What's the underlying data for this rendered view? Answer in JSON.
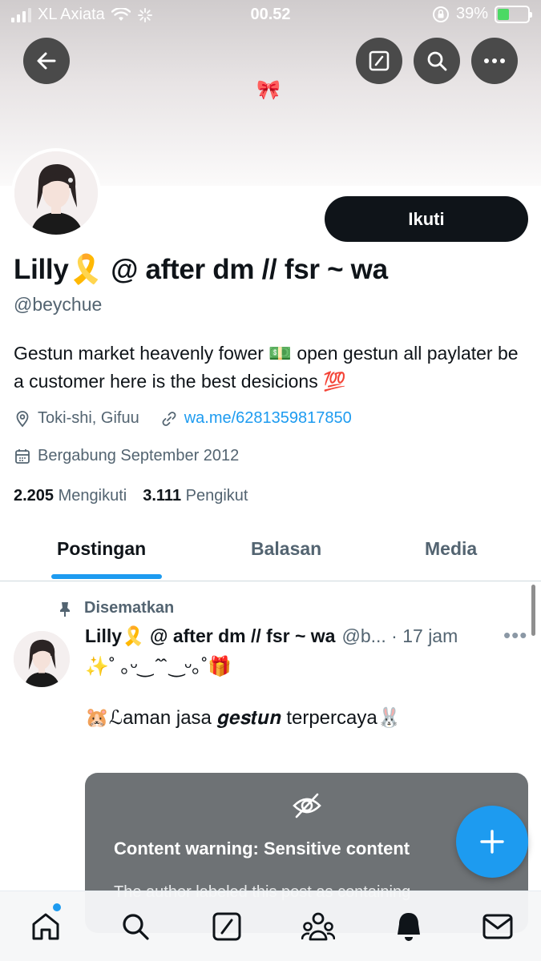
{
  "status_bar": {
    "carrier": "XL Axiata",
    "time": "00.52",
    "battery": "39%",
    "battery_level": 0.39
  },
  "header": {
    "icons": [
      "back-arrow-icon",
      "compose-icon",
      "search-icon",
      "more-icon",
      "bow-icon"
    ],
    "bow": "🎀"
  },
  "profile": {
    "display_name": "Lilly🎗️  @ after dm // fsr ~ wa",
    "handle": "@beychue",
    "bio": "Gestun market heavenly fower 💵 open gestun all paylater be a customer here is the best desicions 💯",
    "location": "Toki-shi, Gifuu",
    "website": "wa.me/6281359817850",
    "joined": "Bergabung September 2012",
    "following_count": "2.205",
    "following_label": "Mengikuti",
    "followers_count": "3.111",
    "followers_label": "Pengikut",
    "follow_button": "Ikuti"
  },
  "tabs": [
    {
      "label": "Postingan",
      "active": true
    },
    {
      "label": "Balasan",
      "active": false
    },
    {
      "label": "Media",
      "active": false
    }
  ],
  "post": {
    "pinned_label": "Disematkan",
    "author_name": "Lilly🎗️  @ after dm // fsr ~ wa",
    "author_meta": "@b... · 17 jam",
    "line1": "✨˚ ｡ᵕ‿ ̂ ̂ ‿ᵕ｡˚🎁",
    "line2": "🐹ℒaman jasa 𝒈𝒆𝒔𝒕𝒖𝒏 terpercaya🐰",
    "warning_title": "Content warning: Sensitive content",
    "warning_body": "The author labeled this post as containing"
  },
  "colors": {
    "accent": "#1d9bf0",
    "text": "#0f1419",
    "secondary": "#536471",
    "warning_bg": "#6e7275"
  },
  "bottom_nav": [
    "home-icon",
    "search-icon",
    "grok-icon",
    "communities-icon",
    "notifications-icon",
    "messages-icon"
  ]
}
